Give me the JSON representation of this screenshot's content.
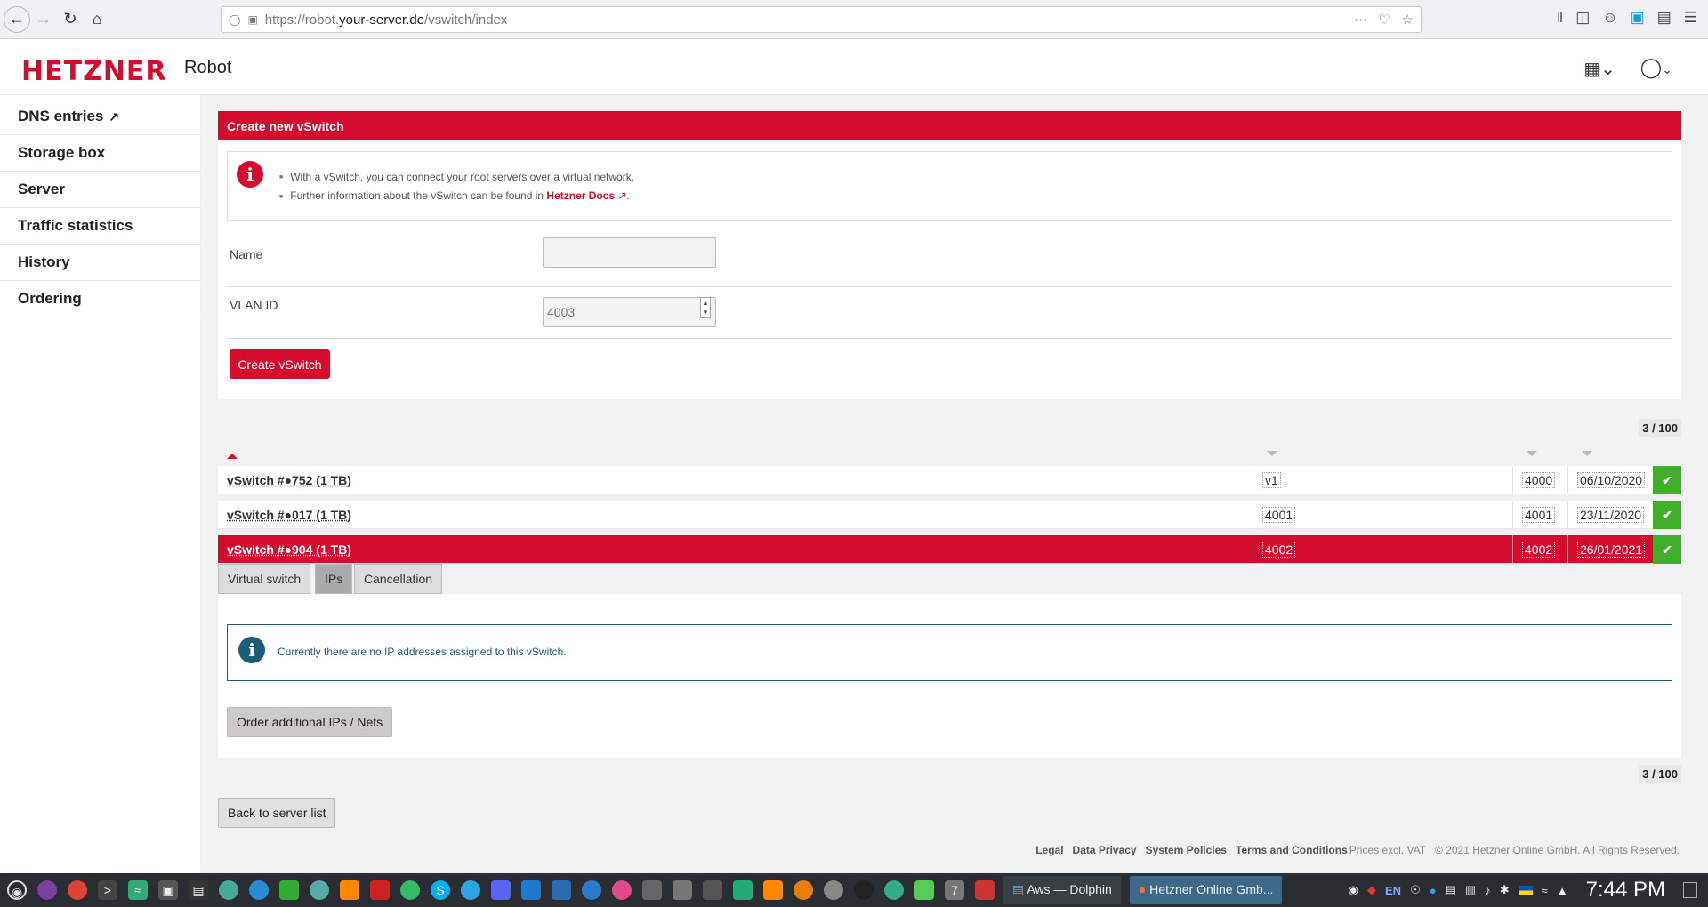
{
  "browser": {
    "url_prefix": "https://robot.",
    "url_domain": "your-server.de",
    "url_path": "/vswitch/index"
  },
  "header": {
    "logo": "HETZNER",
    "product": "Robot"
  },
  "sidebar": {
    "items": [
      {
        "label": "DNS entries"
      },
      {
        "label": "Storage box"
      },
      {
        "label": "Server"
      },
      {
        "label": "Traffic statistics"
      },
      {
        "label": "History"
      },
      {
        "label": "Ordering"
      }
    ]
  },
  "create_panel": {
    "title": "Create new vSwitch",
    "info_1": "With a vSwitch, you can connect your root servers over a virtual network.",
    "info_2_prefix": "Further information about the vSwitch can be found in ",
    "info_2_link": "Hetzner Docs",
    "name_label": "Name",
    "name_value": "",
    "vlan_label": "VLAN ID",
    "vlan_value": "4003",
    "create_button": "Create vSwitch"
  },
  "counter": "3 / 100",
  "vswitches": [
    {
      "name": "vSwitch #●752 (1 TB)",
      "alias": "v1",
      "vlan": "4000",
      "date": "06/10/2020"
    },
    {
      "name": "vSwitch #●017 (1 TB)",
      "alias": "4001",
      "vlan": "4001",
      "date": "23/11/2020"
    },
    {
      "name": "vSwitch #●904 (1 TB)",
      "alias": "4002",
      "vlan": "4002",
      "date": "26/01/2021"
    }
  ],
  "tabs": [
    {
      "label": "Virtual switch"
    },
    {
      "label": "IPs"
    },
    {
      "label": "Cancellation"
    }
  ],
  "detail": {
    "no_ip_message": "Currently there are no IP addresses assigned to this vSwitch.",
    "order_button": "Order additional IPs / Nets"
  },
  "back_button": "Back to server list",
  "footer": {
    "links": [
      "Legal",
      "Data Privacy",
      "System Policies",
      "Terms and Conditions"
    ],
    "prices": "Prices excl. VAT",
    "copyright": "© 2021 Hetzner Online GmbH. All Rights Reserved."
  },
  "taskbar": {
    "tasks": [
      "Aws — Dolphin",
      "Hetzner Online Gmb..."
    ],
    "lang": "EN",
    "clock": "7:44 PM"
  },
  "colors": {
    "brand": "#d50c2d",
    "success": "#3fae29",
    "info": "#1d5c78"
  }
}
